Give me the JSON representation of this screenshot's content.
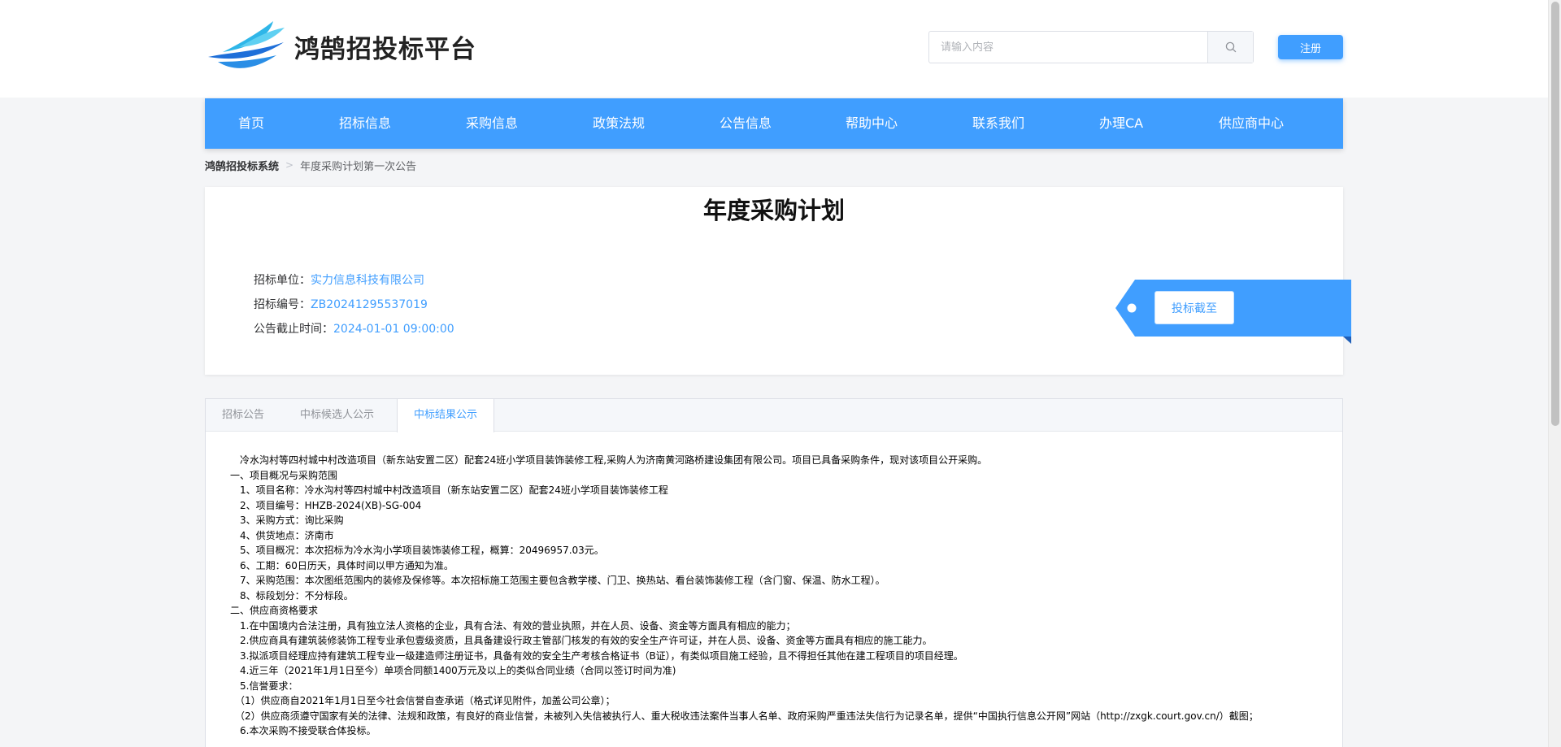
{
  "header": {
    "logo_text": "鸿鹄招投标平台",
    "search_placeholder": "请输入内容",
    "register_label": "注册"
  },
  "nav": {
    "items": [
      "首页",
      "招标信息",
      "采购信息",
      "政策法规",
      "公告信息",
      "帮助中心",
      "联系我们",
      "办理CA",
      "供应商中心"
    ]
  },
  "breadcrumb": {
    "root": "鸿鹄招投标系统",
    "current": "年度采购计划第一次公告"
  },
  "notice": {
    "title": "年度采购计划",
    "unit_label": "招标单位：",
    "unit_value": "实力信息科技有限公司",
    "code_label": "招标编号：",
    "code_value": "ZB20241295537019",
    "deadline_label": "公告截止时间：",
    "deadline_value": "2024-01-01 09:00:00",
    "deadline_button": "投标截至"
  },
  "tabs": {
    "items": [
      "招标公告",
      "中标候选人公示",
      "中标结果公示"
    ],
    "active_index": 2
  },
  "content": {
    "lines": [
      "　冷水沟村等四村城中村改造项目（新东站安置二区）配套24班小学项目装饰装修工程,采购人为济南黄河路桥建设集团有限公司。项目已具备采购条件，现对该项目公开采购。",
      "一、项目概况与采购范围",
      "　1、项目名称：冷水沟村等四村城中村改造项目（新东站安置二区）配套24班小学项目装饰装修工程",
      "　2、项目编号：HHZB-2024(XB)-SG-004",
      "　3、采购方式：询比采购",
      "　4、供货地点：济南市",
      "　5、项目概况：本次招标为冷水沟小学项目装饰装修工程，概算：20496957.03元。",
      "　6、工期：60日历天，具体时间以甲方通知为准。",
      "　7、采购范围：本次图纸范围内的装修及保修等。本次招标施工范围主要包含教学楼、门卫、换热站、看台装饰装修工程（含门窗、保温、防水工程）。",
      "　8、标段划分：不分标段。",
      "二、供应商资格要求",
      "　1.在中国境内合法注册，具有独立法人资格的企业，具有合法、有效的营业执照，并在人员、设备、资金等方面具有相应的能力；",
      "　2.供应商具有建筑装修装饰工程专业承包壹级资质，且具备建设行政主管部门核发的有效的安全生产许可证，并在人员、设备、资金等方面具有相应的施工能力。",
      "　3.拟派项目经理应持有建筑工程专业一级建造师注册证书，具备有效的安全生产考核合格证书（B证），有类似项目施工经验，且不得担任其他在建工程项目的项目经理。",
      "　4.近三年（2021年1月1日至今）单项合同额1400万元及以上的类似合同业绩（合同以签订时间为准)",
      "　5.信誉要求：",
      "　（1）供应商自2021年1月1日至今社会信誉自查承诺（格式详见附件，加盖公司公章）；",
      "　（2）供应商须遵守国家有关的法律、法规和政策，有良好的商业信誉，未被列入失信被执行人、重大税收违法案件当事人名单、政府采购严重违法失信行为记录名单，提供“中国执行信息公开网”网站（http://zxgk.court.gov.cn/）截图；",
      "　6.本次采购不接受联合体投标。"
    ]
  }
}
